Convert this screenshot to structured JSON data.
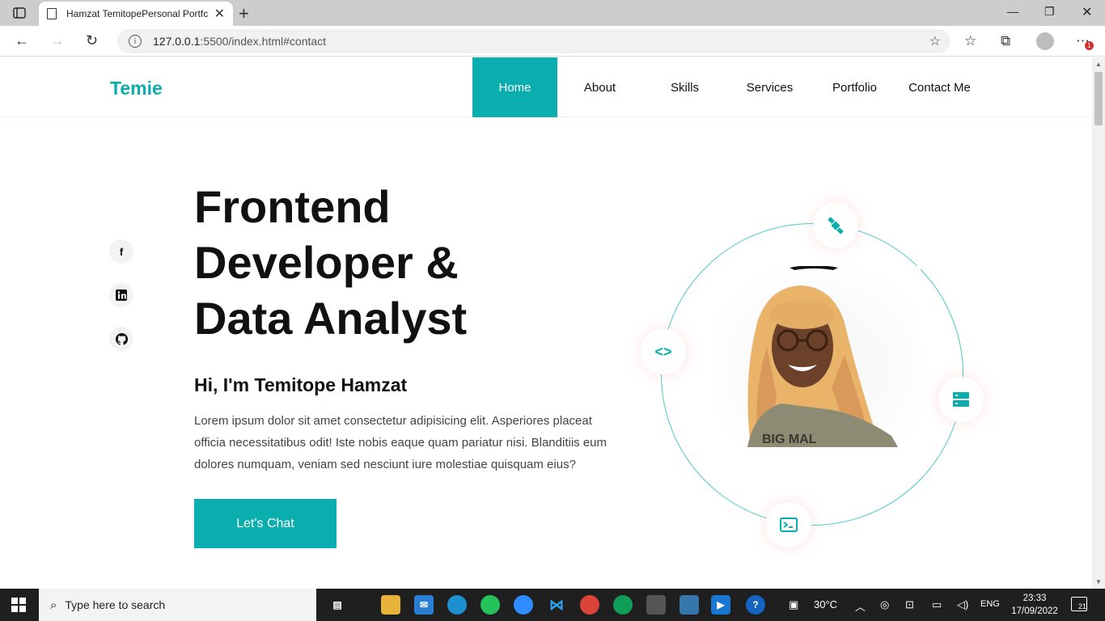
{
  "browser": {
    "tab_title": "Hamzat TemitopePersonal Portfc",
    "url_host": "127.0.0.1",
    "url_rest": ":5500/index.html#contact"
  },
  "site": {
    "logo": "Temie",
    "nav": [
      "Home",
      "About",
      "Skills",
      "Services",
      "Portfolio",
      "Contact Me"
    ],
    "active_nav": "Home",
    "headline_lines": [
      "Frontend",
      "Developer &",
      "Data Analyst"
    ],
    "subtitle": "Hi, I'm Temitope Hamzat",
    "description": "Lorem ipsum dolor sit amet consectetur adipisicing elit. Asperiores placeat officia necessitatibus odit! Iste nobis eaque quam pariatur nisi. Blanditiis eum dolores numquam, veniam sed nesciunt iure molestiae quisquam eius?",
    "cta_label": "Let's Chat",
    "social": [
      "facebook-icon",
      "linkedin-icon",
      "github-icon"
    ],
    "orbit_icons": [
      "satellite-icon",
      "code-icon",
      "server-icon",
      "terminal-icon"
    ],
    "accent_color": "#0aaeae"
  },
  "taskbar": {
    "search_placeholder": "Type here to search",
    "temperature": "30°C",
    "language": "ENG",
    "time": "23:33",
    "date": "17/09/2022",
    "notifications": "21"
  }
}
